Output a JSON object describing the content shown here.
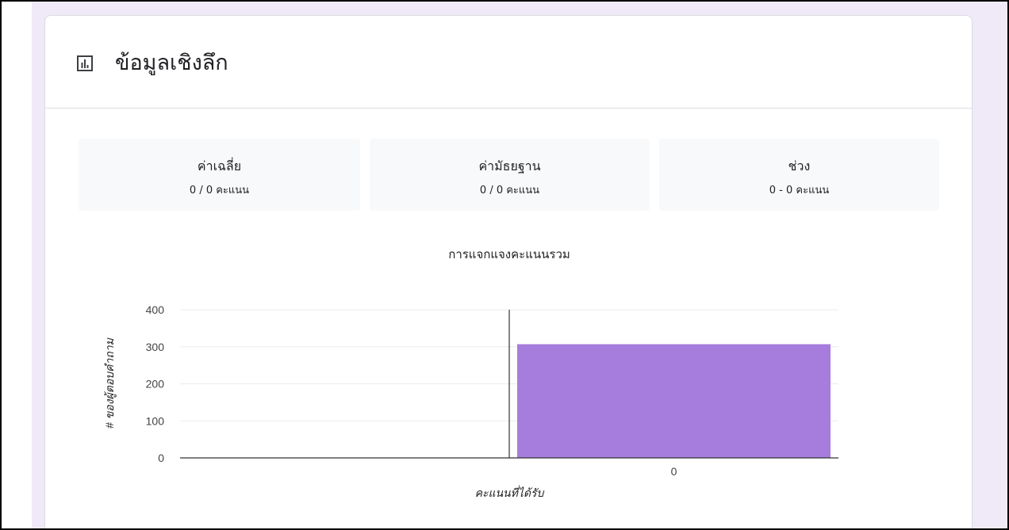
{
  "header": {
    "title": "ข้อมูลเชิงลึก",
    "icon": "bar-chart-icon"
  },
  "stats": [
    {
      "label": "ค่าเฉลี่ย",
      "value": "0 / 0 คะแนน"
    },
    {
      "label": "ค่ามัธยฐาน",
      "value": "0 / 0 คะแนน"
    },
    {
      "label": "ช่วง",
      "value": "0 - 0 คะแนน"
    }
  ],
  "colors": {
    "bar": "#a67ddc",
    "background": "#efe9f8"
  },
  "chart_data": {
    "type": "bar",
    "title": "การแจกแจงคะแนนรวม",
    "xlabel": "คะแนนที่ได้รับ",
    "ylabel": "# ของผู้ตอบคำถาม",
    "categories": [
      "0"
    ],
    "values": [
      307
    ],
    "ylim": [
      0,
      400
    ],
    "yticks": [
      0,
      100,
      200,
      300,
      400
    ],
    "grid": true
  }
}
